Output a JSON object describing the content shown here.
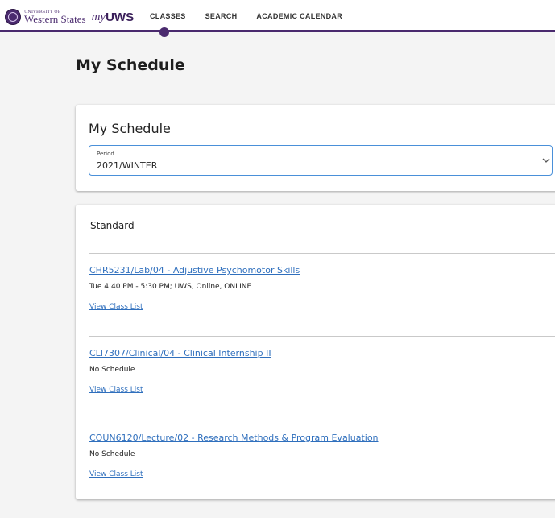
{
  "header": {
    "brand_small": "University of",
    "brand_big": "Western States",
    "brand_my": "my",
    "brand_uws": "UWS",
    "colors": {
      "brand_purple": "#4a2a6e",
      "link_blue": "#2f6fbd",
      "focus_blue": "#4a90d9"
    },
    "nav": [
      {
        "label": "CLASSES",
        "active": true
      },
      {
        "label": "SEARCH",
        "active": false
      },
      {
        "label": "ACADEMIC CALENDAR",
        "active": false
      }
    ]
  },
  "page": {
    "title": "My Schedule"
  },
  "schedule_card": {
    "title": "My Schedule",
    "period_select": {
      "label": "Period",
      "value": "2021/WINTER",
      "icon": "chevron-down-icon"
    }
  },
  "courses_card": {
    "heading": "Standard",
    "courses": [
      {
        "title": "CHR5231/Lab/04 - Adjustive Psychomotor Skills",
        "schedule": "Tue 4:40 PM - 5:30 PM; UWS, Online, ONLINE",
        "action": "View Class List"
      },
      {
        "title": "CLI7307/Clinical/04 - Clinical Internship II",
        "schedule": "No Schedule",
        "action": "View Class List"
      },
      {
        "title": "COUN6120/Lecture/02 - Research Methods & Program Evaluation",
        "schedule": "No Schedule",
        "action": "View Class List"
      }
    ]
  }
}
